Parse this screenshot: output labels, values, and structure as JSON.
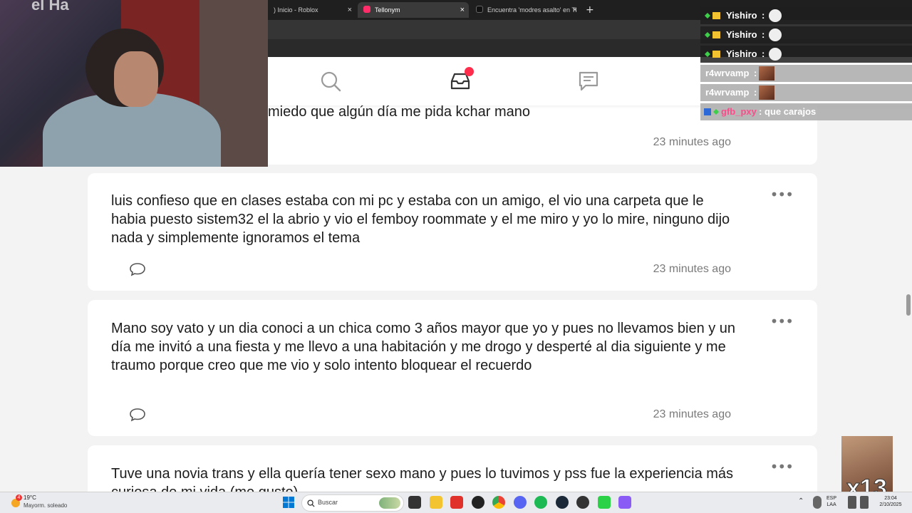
{
  "browser": {
    "tabs": [
      {
        "label": ") Inicio - Roblox",
        "active": false
      },
      {
        "label": "Tellonym",
        "active": true
      },
      {
        "label": "Encuentra 'modres asalto' en Ti",
        "active": false
      }
    ],
    "new_tab_label": "+",
    "close_glyph": "×"
  },
  "nav": {
    "icons": [
      "search-icon",
      "inbox-icon",
      "chat-icon"
    ],
    "inbox_has_notification": true
  },
  "webcam": {
    "overlay_text": "el Ha"
  },
  "chat": {
    "messages": [
      {
        "user": "Yishiro",
        "separator": ":",
        "style": "dark"
      },
      {
        "user": "Yishiro",
        "separator": ":",
        "style": "dark"
      },
      {
        "user": "Yishiro",
        "separator": ":",
        "style": "dark"
      },
      {
        "user": "r4wrvamp",
        "separator": ":",
        "style": "light"
      },
      {
        "user": "r4wrvamp",
        "separator": ":",
        "style": "light"
      },
      {
        "user": "gfb_pxy",
        "separator": ":",
        "message": "que carajos",
        "style": "light"
      }
    ]
  },
  "feed": {
    "cards": [
      {
        "text": "miedo que algún día me pida kchar mano",
        "time": "23 minutes ago",
        "more": "•••"
      },
      {
        "text": "luis confieso que en clases estaba con mi pc y estaba con un amigo, el vio una carpeta que le habia puesto sistem32 el la abrio y vio el femboy roommate y el me miro y yo lo mire, ninguno dijo nada y simplemente ignoramos el tema",
        "time": "23 minutes ago",
        "more": "•••"
      },
      {
        "text": "Mano soy vato y un dia conoci a un chica como 3 años mayor que yo y pues no llevamos bien y un día me invitó a una fiesta y me llevo a una habitación y me drogo y desperté al dia siguiente y me traumo porque creo que me vio y solo intento bloquear el recuerdo",
        "time": "23 minutes ago",
        "more": "•••"
      },
      {
        "text": "Tuve una novia trans y ella quería tener sexo mano y pues lo tuvimos y pss fue la experiencia más curiosa de mi vida (me gusto)",
        "more": "•••"
      }
    ]
  },
  "sticker": {
    "text": "x13"
  },
  "taskbar": {
    "weather_temp": "19°C",
    "weather_condition": "Mayorm. soleado",
    "weather_badge": "4",
    "search_placeholder": "Buscar",
    "language_top": "ESP",
    "language_bottom": "LAA",
    "time": "23:04",
    "date": "2/10/2025"
  },
  "colors": {
    "accent_notification": "#ff2d4b",
    "tellonym_tab": "#ff2d6a",
    "chat_user_dark": "#ffffff",
    "chat_user_pink": "#ff4a8a"
  }
}
